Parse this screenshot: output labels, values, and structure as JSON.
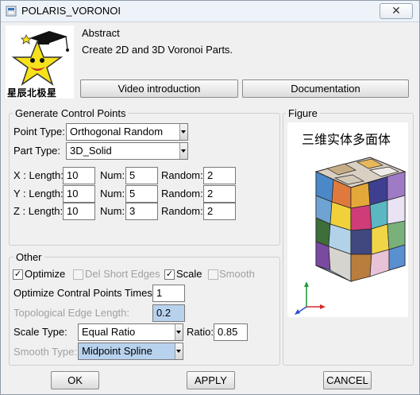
{
  "window": {
    "title": "POLARIS_VORONOI",
    "close_glyph": "✕"
  },
  "logo": {
    "text": "星辰北极星"
  },
  "abstract": {
    "title": "Abstract",
    "text": "Create 2D and 3D Voronoi Parts.",
    "video_button": "Video introduction",
    "docs_button": "Documentation"
  },
  "control_points": {
    "title": "Generate Control Points",
    "point_type_label": "Point Type:",
    "point_type_value": "Orthogonal Random",
    "part_type_label": "Part Type:",
    "part_type_value": "3D_Solid",
    "rows": [
      {
        "label": "X : Length:",
        "length": "10",
        "num_label": "Num:",
        "num": "5",
        "random_label": "Random:",
        "random": "2"
      },
      {
        "label": "Y : Length:",
        "length": "10",
        "num_label": "Num:",
        "num": "5",
        "random_label": "Random:",
        "random": "2"
      },
      {
        "label": "Z : Length:",
        "length": "10",
        "num_label": "Num:",
        "num": "3",
        "random_label": "Random:",
        "random": "2"
      }
    ]
  },
  "figure": {
    "title": "Figure",
    "caption": "三维实体多面体"
  },
  "other": {
    "title": "Other",
    "optimize_label": "Optimize",
    "optimize_checked": true,
    "del_short_label": "Del Short Edges",
    "del_short_checked": false,
    "scale_label": "Scale",
    "scale_checked": true,
    "smooth_label": "Smooth",
    "smooth_checked": false,
    "opt_times_label": "Optimize Contral Points Times:",
    "opt_times_value": "1",
    "topo_label": "Topological Edge Length:",
    "topo_value": "0.2",
    "scale_type_label": "Scale Type:",
    "scale_type_value": "Equal Ratio",
    "ratio_label": "Ratio:",
    "ratio_value": "0.85",
    "smooth_type_label": "Smooth Type:",
    "smooth_type_value": "Midpoint Spline"
  },
  "footer": {
    "ok": "OK",
    "apply": "APPLY",
    "cancel": "CANCEL"
  },
  "colors": {
    "accent_highlight": "#b8d2ee",
    "titlebar": "#eef3fa"
  }
}
